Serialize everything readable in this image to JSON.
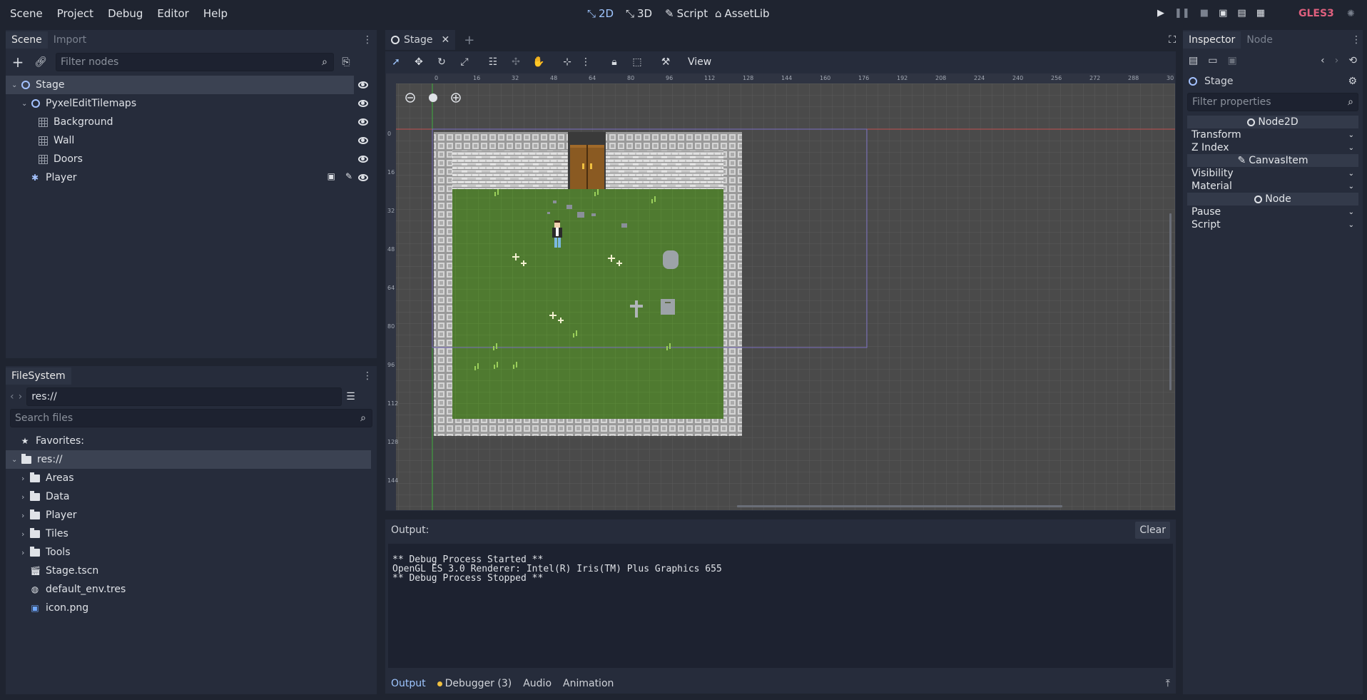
{
  "menu": {
    "items": [
      "Scene",
      "Project",
      "Debug",
      "Editor",
      "Help"
    ]
  },
  "modes": {
    "m2d": "2D",
    "m3d": "3D",
    "script": "Script",
    "assetlib": "AssetLib"
  },
  "renderer": "GLES3",
  "colors": {
    "accent": "#9fc6ff",
    "renderer": "#e0607e",
    "grass": "#4f7a30",
    "wall": "#c8c8c8"
  },
  "scene_dock": {
    "tabs": [
      "Scene",
      "Import"
    ],
    "filter_placeholder": "Filter nodes",
    "nodes": [
      {
        "label": "Stage",
        "icon": "node2d-icon"
      },
      {
        "label": "PyxelEditTilemaps",
        "icon": "node2d-icon"
      },
      {
        "label": "Background",
        "icon": "tilemap-icon"
      },
      {
        "label": "Wall",
        "icon": "tilemap-icon"
      },
      {
        "label": "Doors",
        "icon": "tilemap-icon"
      },
      {
        "label": "Player",
        "icon": "kinematic-body-icon"
      }
    ]
  },
  "filesystem": {
    "tab": "FileSystem",
    "path": "res://",
    "search_placeholder": "Search files",
    "favorites": "Favorites:",
    "root": "res://",
    "folders": [
      "Areas",
      "Data",
      "Player",
      "Tiles",
      "Tools"
    ],
    "files": [
      "Stage.tscn",
      "default_env.tres",
      "icon.png"
    ]
  },
  "editor_tab": {
    "name": "Stage"
  },
  "toolbar": {
    "view": "View"
  },
  "ruler": {
    "top": [
      "0",
      "16",
      "32",
      "48",
      "64",
      "80",
      "96",
      "112",
      "128",
      "144",
      "160",
      "176",
      "192",
      "208",
      "224",
      "240",
      "256",
      "272",
      "288",
      "30"
    ],
    "left": [
      "0",
      "16",
      "32",
      "48",
      "64",
      "80",
      "96",
      "112",
      "128",
      "144"
    ]
  },
  "output": {
    "label": "Output:",
    "clear": "Clear",
    "lines": [
      "** Debug Process Started **",
      "OpenGL ES 3.0 Renderer: Intel(R) Iris(TM) Plus Graphics 655",
      "** Debug Process Stopped **"
    ]
  },
  "bottom_tabs": {
    "output": "Output",
    "debugger": "Debugger (3)",
    "audio": "Audio",
    "animation": "Animation"
  },
  "inspector": {
    "tabs": [
      "Inspector",
      "Node"
    ],
    "object": "Stage",
    "filter_placeholder": "Filter properties",
    "sections": [
      {
        "header": "Node2D",
        "props": [
          "Transform",
          "Z Index"
        ]
      },
      {
        "header": "CanvasItem",
        "props": [
          "Visibility",
          "Material"
        ]
      },
      {
        "header": "Node",
        "props": [
          "Pause",
          "Script"
        ]
      }
    ]
  }
}
